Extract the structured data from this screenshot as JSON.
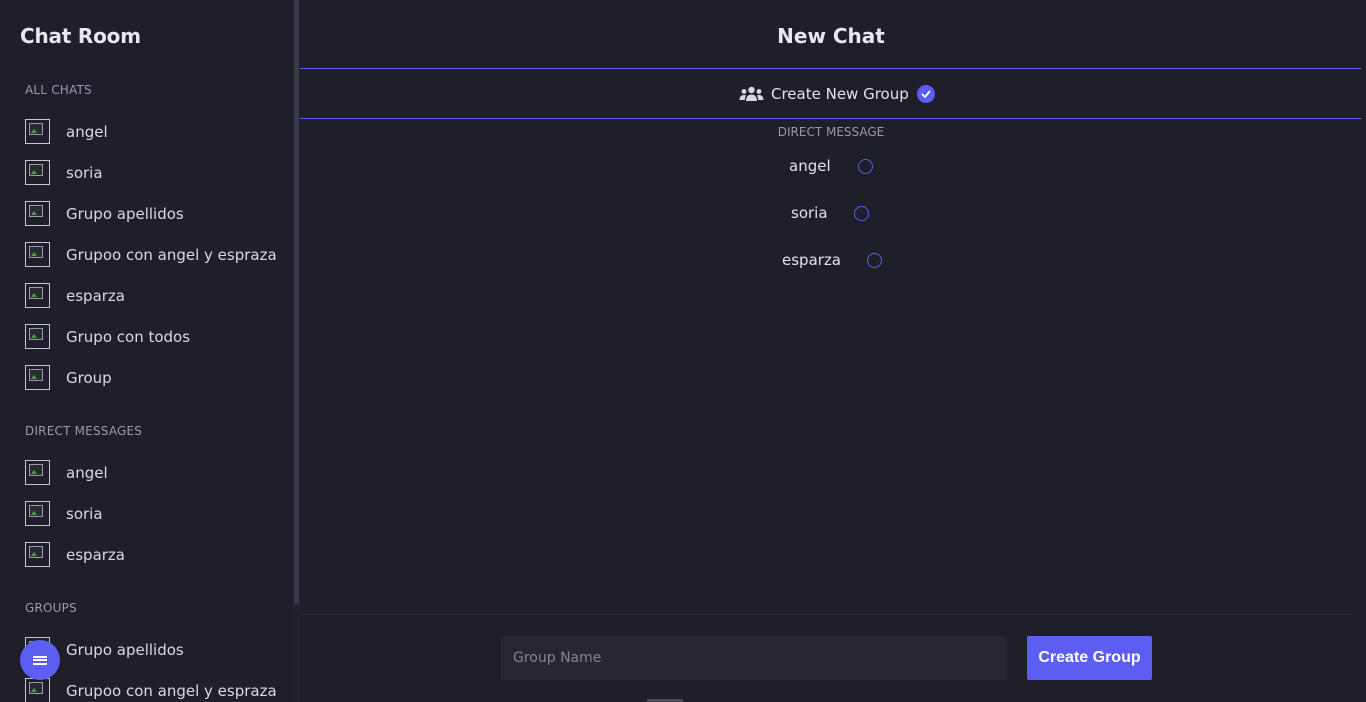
{
  "sidebar": {
    "title": "Chat Room",
    "sections": {
      "all_chats": {
        "label": "ALL CHATS",
        "items": [
          "angel",
          "soria",
          "Grupo apellidos",
          "Grupoo con angel y espraza",
          "esparza",
          "Grupo con todos",
          "Group"
        ]
      },
      "direct_messages": {
        "label": "DIRECT MESSAGES",
        "items": [
          "angel",
          "soria",
          "esparza"
        ]
      },
      "groups": {
        "label": "GROUPS",
        "items": [
          "Grupo apellidos",
          "Grupoo con angel y espraza"
        ]
      }
    },
    "menu_icon": "hamburger-menu-icon"
  },
  "main": {
    "title": "New Chat",
    "create_group": {
      "icon": "users-group-icon",
      "label": "Create New Group",
      "checked": true
    },
    "direct_message": {
      "heading": "DIRECT MESSAGE",
      "contacts": [
        "angel",
        "soria",
        "esparza"
      ]
    },
    "group_name_placeholder": "Group Name",
    "create_button": "Create Group"
  },
  "colors": {
    "accent": "#5b5ef0",
    "background": "#1f1f29",
    "input_bg": "#272730"
  }
}
